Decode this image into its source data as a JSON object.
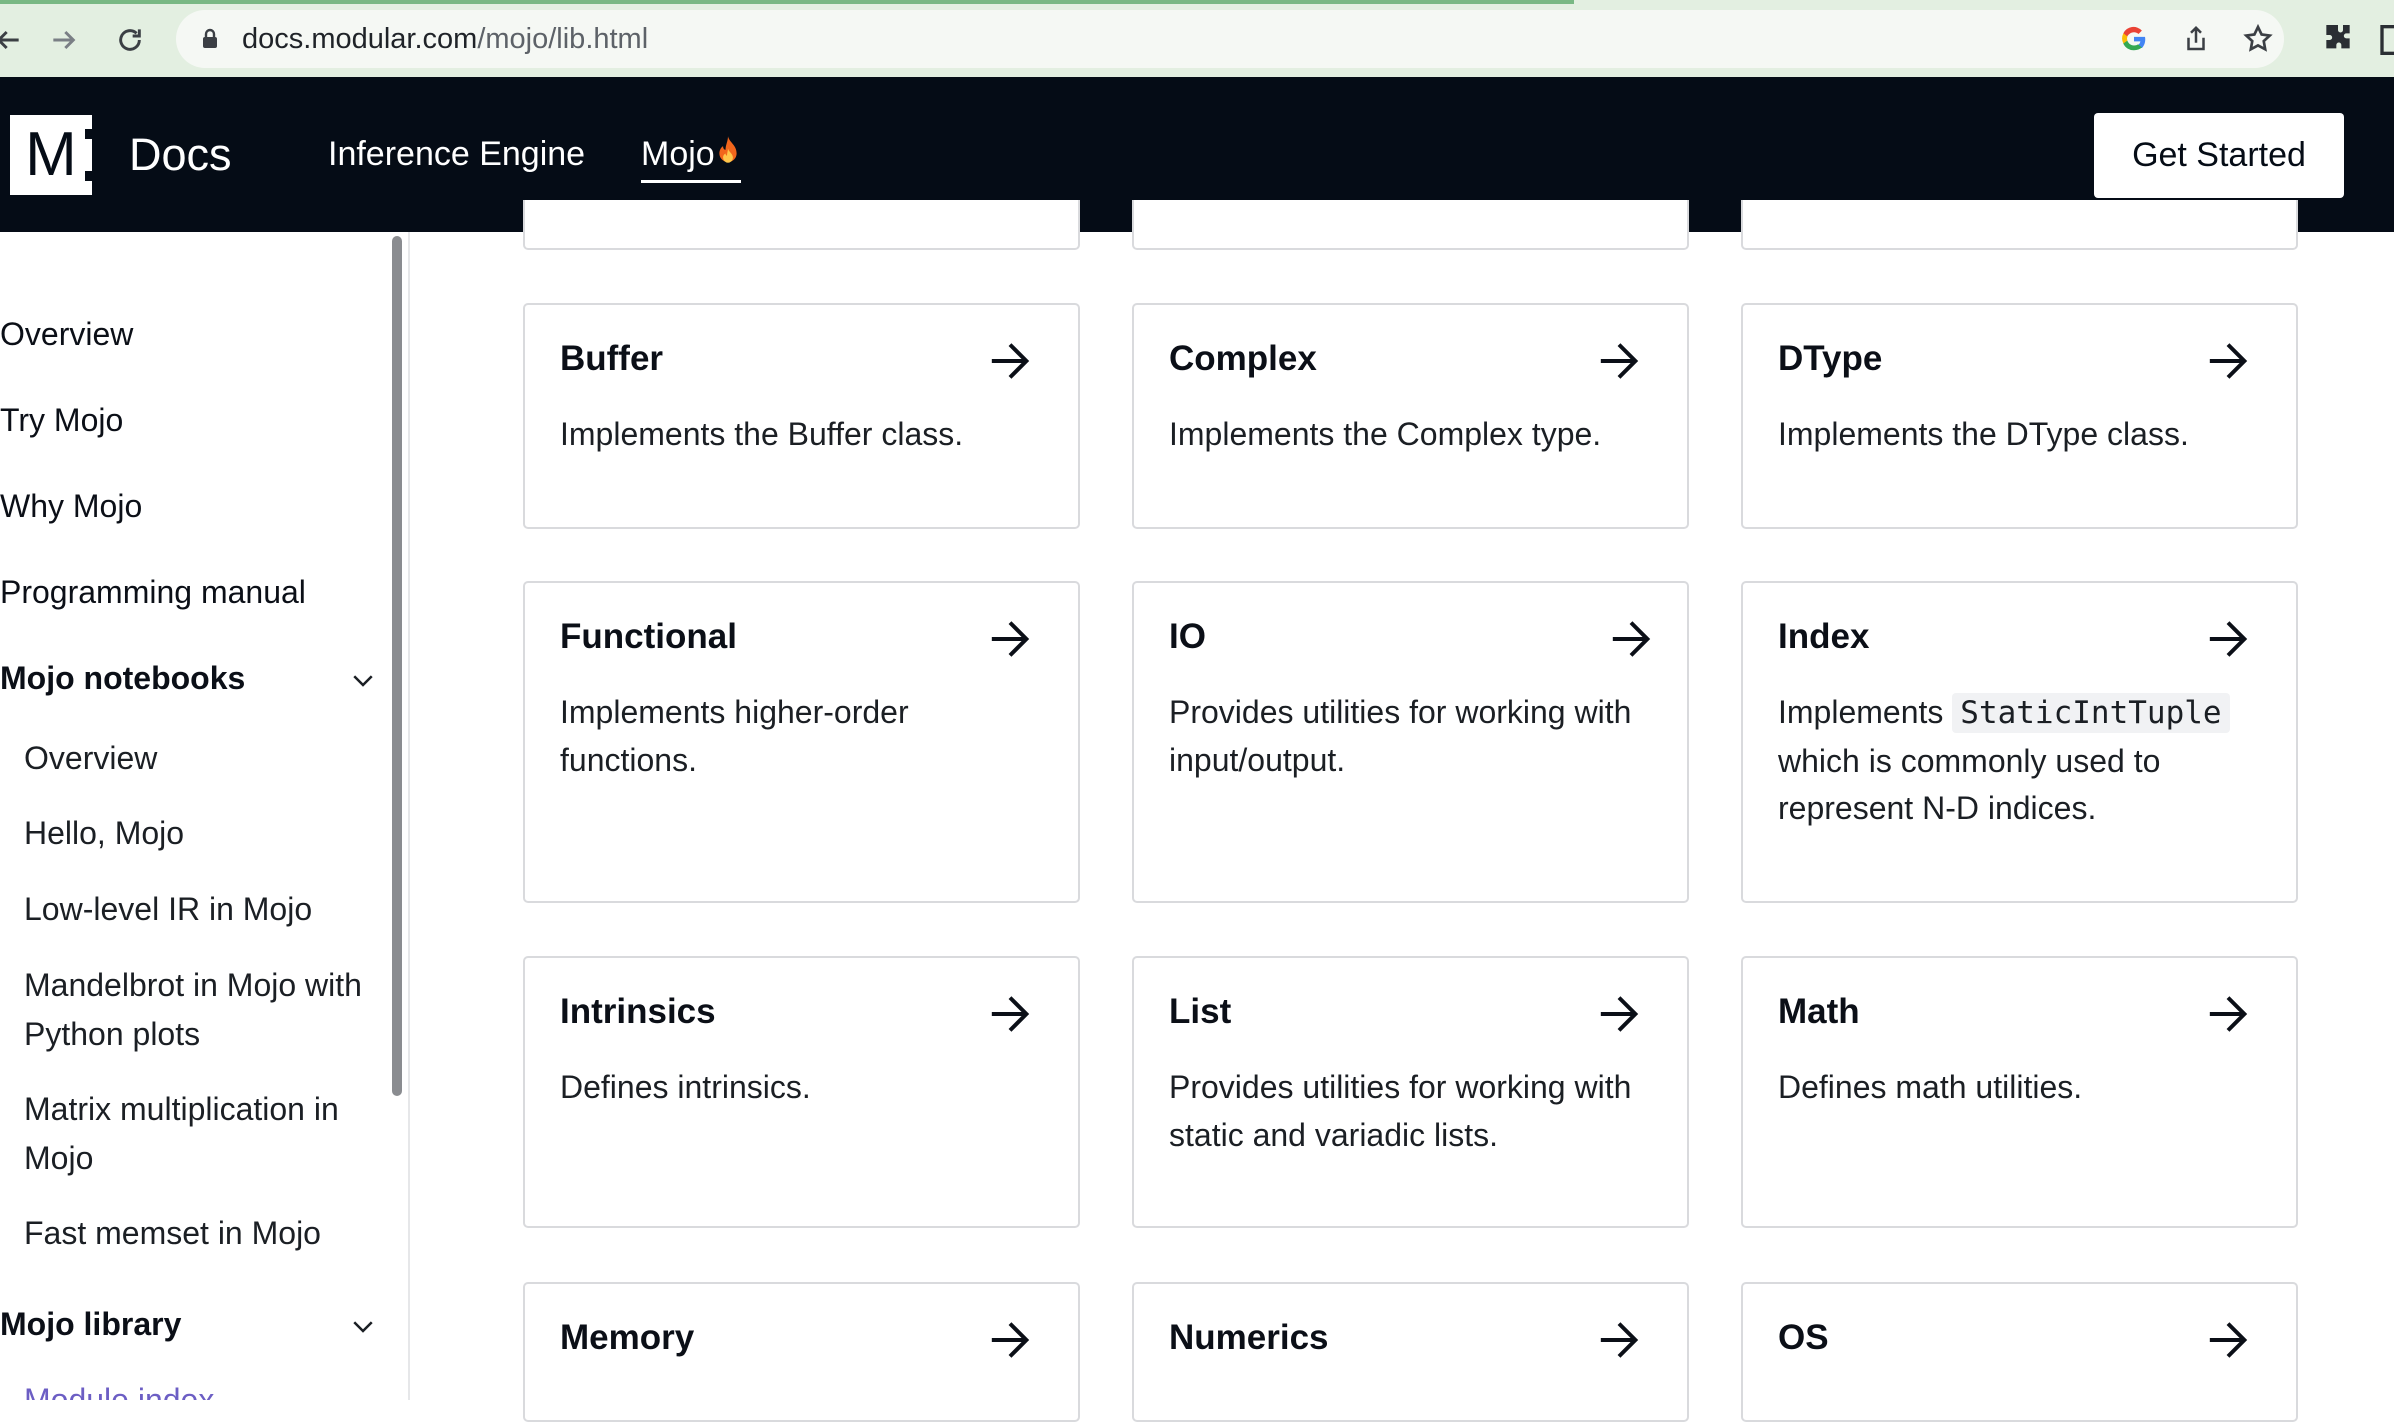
{
  "browser": {
    "url_host": "docs.modular.com",
    "url_path": "/mojo/lib.html"
  },
  "header": {
    "logo_letter": "M",
    "logo_text": "Docs",
    "nav": [
      {
        "label": "Inference Engine"
      },
      {
        "label": "Mojo"
      }
    ],
    "cta_label": "Get Started"
  },
  "sidebar": {
    "items": [
      {
        "label": "Overview"
      },
      {
        "label": "Try Mojo"
      },
      {
        "label": "Why Mojo"
      },
      {
        "label": "Programming manual"
      }
    ],
    "notebooks_section": "Mojo notebooks",
    "notebooks": [
      {
        "label": "Overview"
      },
      {
        "label": "Hello, Mojo"
      },
      {
        "label": "Low-level IR in Mojo"
      },
      {
        "label": "Mandelbrot in Mojo with Python plots"
      },
      {
        "label": "Matrix multiplication in Mojo"
      },
      {
        "label": "Fast memset in Mojo"
      }
    ],
    "library_section": "Mojo library",
    "library_first": "Module index"
  },
  "cards": [
    {
      "title": "Buffer",
      "desc": "Implements the Buffer class."
    },
    {
      "title": "Complex",
      "desc": "Implements the Complex type."
    },
    {
      "title": "DType",
      "desc": "Implements the DType class."
    },
    {
      "title": "Functional",
      "desc": "Implements higher-order functions."
    },
    {
      "title": "IO",
      "desc": "Provides utilities for working with input/output."
    },
    {
      "title": "Index",
      "desc_prefix": "Implements",
      "desc_code": "StaticIntTuple",
      "desc_suffix": "which is commonly used to represent N-D indices."
    },
    {
      "title": "Intrinsics",
      "desc": "Defines intrinsics."
    },
    {
      "title": "List",
      "desc": "Provides utilities for working with static and variadic lists."
    },
    {
      "title": "Math",
      "desc": "Defines math utilities."
    },
    {
      "title": "Memory",
      "desc": ""
    },
    {
      "title": "Numerics",
      "desc": ""
    },
    {
      "title": "OS",
      "desc": ""
    }
  ]
}
